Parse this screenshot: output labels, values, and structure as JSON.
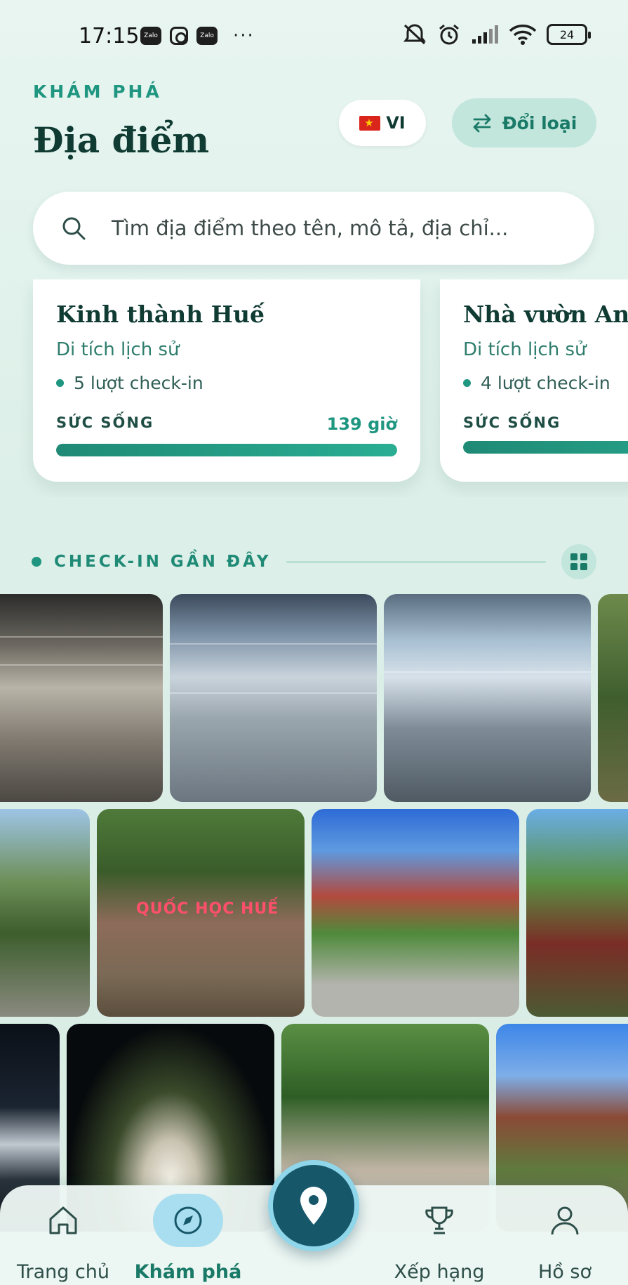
{
  "status_bar": {
    "time": "17:15",
    "app_icons": [
      "zalo-icon",
      "instagram-icon",
      "zalo-icon"
    ],
    "more": "···",
    "battery": "24"
  },
  "header": {
    "kicker": "KHÁM PHÁ",
    "title": "Địa điểm",
    "language": "VI",
    "switch_label": "Đổi loại"
  },
  "search": {
    "placeholder": "Tìm địa điểm theo tên, mô tả, địa chỉ..."
  },
  "places": [
    {
      "name": "Kinh thành Huế",
      "category": "Di tích lịch sử",
      "checkins": "5 lượt check-in",
      "vitality_label": "SỨC SỐNG",
      "vitality_hours": "139 giờ",
      "vitality_fraction": 1.0
    },
    {
      "name": "Nhà vườn An Hiên",
      "category": "Di tích lịch sử",
      "checkins": "4 lượt check-in",
      "vitality_label": "SỨC SỐNG",
      "vitality_hours": "",
      "vitality_fraction": 1.0
    }
  ],
  "recent": {
    "title": "CHECK-IN GẦN ĐÂY",
    "photos_row1": [
      "airport-hall-photo",
      "airport-terminal-photo",
      "airport-checkin-photo",
      "tree-photo"
    ],
    "photos_row2": [
      "lotus-pond-photo",
      "quoc-hoc-hue-photo",
      "red-building-photo",
      "garden-photo"
    ],
    "photos_row3": [
      "night-river-photo",
      "night-monument-photo",
      "tree-lined-path-photo",
      "citadel-gate-photo"
    ],
    "sign_text": "QUỐC HỌC HUẾ"
  },
  "nav": {
    "home": "Trang chủ",
    "explore": "Khám phá",
    "ranking": "Xếp hạng",
    "profile": "Hồ sơ"
  },
  "colors": {
    "accent": "#1f9680",
    "title": "#0f3b33",
    "fab": "#16576a",
    "fab_ring": "#8fd6ea",
    "explore_pill": "#a9ddf0"
  }
}
